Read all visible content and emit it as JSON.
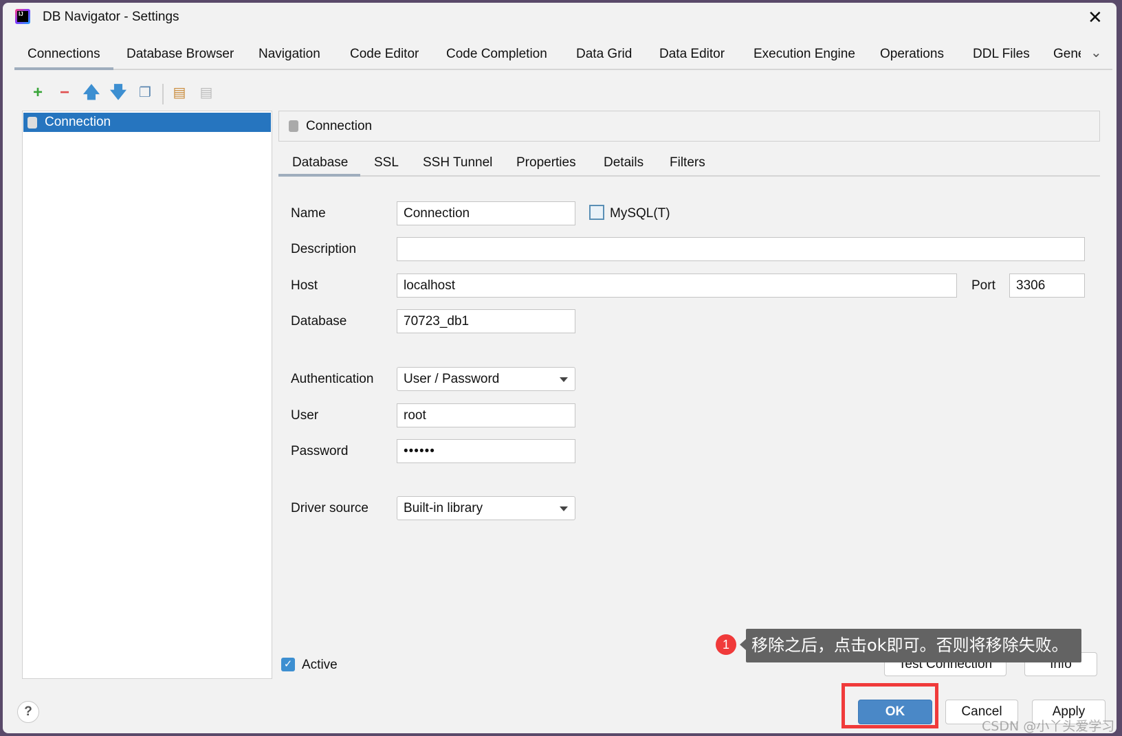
{
  "window": {
    "title": "DB Navigator - Settings",
    "app_icon": "intellij-idea-icon",
    "close_icon": "close-icon"
  },
  "tabs": [
    {
      "label": "Connections",
      "active": true
    },
    {
      "label": "Database Browser"
    },
    {
      "label": "Navigation"
    },
    {
      "label": "Code Editor"
    },
    {
      "label": "Code Completion"
    },
    {
      "label": "Data Grid"
    },
    {
      "label": "Data Editor"
    },
    {
      "label": "Execution Engine"
    },
    {
      "label": "Operations"
    },
    {
      "label": "DDL Files"
    },
    {
      "label": "Gene"
    }
  ],
  "toolbar": {
    "icons": [
      "add-icon",
      "remove-icon",
      "move-up-icon",
      "move-down-icon",
      "copy-icon",
      "export-icon",
      "import-icon"
    ]
  },
  "connections_list": {
    "items": [
      {
        "label": "Connection",
        "selected": true
      }
    ]
  },
  "detail": {
    "header": "Connection",
    "subtabs": [
      {
        "label": "Database",
        "active": true
      },
      {
        "label": "SSL"
      },
      {
        "label": "SSH Tunnel"
      },
      {
        "label": "Properties"
      },
      {
        "label": "Details"
      },
      {
        "label": "Filters"
      }
    ],
    "form": {
      "name_label": "Name",
      "name_value": "Connection",
      "db_type": "MySQL(T)",
      "description_label": "Description",
      "description_value": "",
      "host_label": "Host",
      "host_value": "localhost",
      "port_label": "Port",
      "port_value": "3306",
      "database_label": "Database",
      "database_value": "70723_db1",
      "auth_label": "Authentication",
      "auth_value": "User / Password",
      "user_label": "User",
      "user_value": "root",
      "password_label": "Password",
      "password_value": "••••••",
      "driver_label": "Driver source",
      "driver_value": "Built-in library"
    },
    "active_label": "Active",
    "active_checked": true,
    "test_connection": "Test Connection",
    "info": "Info"
  },
  "annotation": {
    "badge": "1",
    "text": "移除之后，点击ok即可。否则将移除失败。",
    "highlight_color": "#f03a3a"
  },
  "footer": {
    "help": "?",
    "ok": "OK",
    "cancel": "Cancel",
    "apply": "Apply"
  },
  "watermark": "CSDN @小丫头爱学习",
  "colors": {
    "accent": "#2675bf",
    "ok_button": "#4a88c7"
  }
}
